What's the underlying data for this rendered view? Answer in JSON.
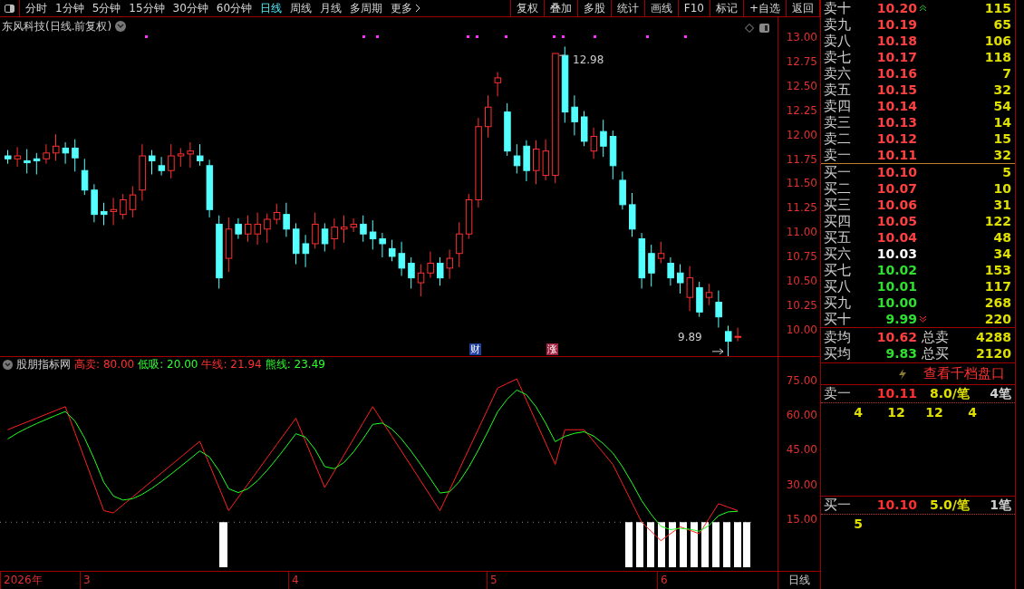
{
  "toolbar": {
    "periods": [
      {
        "label": "分时",
        "selected": false
      },
      {
        "label": "1分钟",
        "selected": false
      },
      {
        "label": "5分钟",
        "selected": false
      },
      {
        "label": "15分钟",
        "selected": false
      },
      {
        "label": "30分钟",
        "selected": false
      },
      {
        "label": "60分钟",
        "selected": false
      },
      {
        "label": "日线",
        "selected": true
      },
      {
        "label": "周线",
        "selected": false
      },
      {
        "label": "月线",
        "selected": false
      },
      {
        "label": "多周期",
        "selected": false
      },
      {
        "label": "更多",
        "selected": false
      }
    ],
    "buttons": [
      "复权",
      "叠加",
      "多股",
      "统计",
      "画线",
      "F10",
      "标记",
      "+自选",
      "返回"
    ]
  },
  "price_chart": {
    "title": "东风科技(日线.前复权)",
    "y_labels": [
      "13.00",
      "12.75",
      "12.50",
      "12.25",
      "12.00",
      "11.75",
      "11.50",
      "11.25",
      "11.00",
      "10.75",
      "10.50",
      "10.25",
      "10.00"
    ],
    "high_label": "12.98",
    "low_label": "9.89",
    "event_markers": [
      "财",
      "涨"
    ]
  },
  "indicator": {
    "name": "股朋指标网",
    "values": [
      {
        "label": "高卖:",
        "value": "80.00",
        "color": "#ff3030"
      },
      {
        "label": "低吸:",
        "value": "20.00",
        "color": "#30ff30"
      },
      {
        "label": "牛线:",
        "value": "21.94",
        "color": "#ff3030"
      },
      {
        "label": "熊线:",
        "value": "23.49",
        "color": "#30ff30"
      }
    ],
    "y_labels": [
      "75.00",
      "60.00",
      "45.00",
      "30.00",
      "15.00"
    ]
  },
  "x_axis": {
    "labels": [
      "2026年",
      "3",
      "4",
      "5",
      "6"
    ],
    "period": "日线"
  },
  "order_book": {
    "asks": [
      {
        "label": "卖十",
        "price": "10.20",
        "qty": "115",
        "color": "#ff4040",
        "limit_up": true
      },
      {
        "label": "卖九",
        "price": "10.19",
        "qty": "65",
        "color": "#ff4040"
      },
      {
        "label": "卖八",
        "price": "10.18",
        "qty": "106",
        "color": "#ff4040"
      },
      {
        "label": "卖七",
        "price": "10.17",
        "qty": "118",
        "color": "#ff4040"
      },
      {
        "label": "卖六",
        "price": "10.16",
        "qty": "7",
        "color": "#ff4040"
      },
      {
        "label": "卖五",
        "price": "10.15",
        "qty": "32",
        "color": "#ff4040"
      },
      {
        "label": "卖四",
        "price": "10.14",
        "qty": "54",
        "color": "#ff4040"
      },
      {
        "label": "卖三",
        "price": "10.13",
        "qty": "14",
        "color": "#ff4040"
      },
      {
        "label": "卖二",
        "price": "10.12",
        "qty": "15",
        "color": "#ff4040"
      },
      {
        "label": "卖一",
        "price": "10.11",
        "qty": "32",
        "color": "#ff4040"
      }
    ],
    "bids": [
      {
        "label": "买一",
        "price": "10.10",
        "qty": "5",
        "color": "#ff4040"
      },
      {
        "label": "买二",
        "price": "10.07",
        "qty": "10",
        "color": "#ff4040"
      },
      {
        "label": "买三",
        "price": "10.06",
        "qty": "31",
        "color": "#ff4040"
      },
      {
        "label": "买四",
        "price": "10.05",
        "qty": "122",
        "color": "#ff4040"
      },
      {
        "label": "买五",
        "price": "10.04",
        "qty": "48",
        "color": "#ff4040"
      },
      {
        "label": "买六",
        "price": "10.03",
        "qty": "34",
        "color": "#ffffff"
      },
      {
        "label": "买七",
        "price": "10.02",
        "qty": "153",
        "color": "#30e030"
      },
      {
        "label": "买八",
        "price": "10.01",
        "qty": "117",
        "color": "#30e030"
      },
      {
        "label": "买九",
        "price": "10.00",
        "qty": "268",
        "color": "#30e030"
      },
      {
        "label": "买十",
        "price": "9.99",
        "qty": "220",
        "color": "#30e030",
        "limit_down": true
      }
    ],
    "summary": [
      {
        "label": "卖均",
        "price": "10.62",
        "color": "#ff4040",
        "total_label": "总卖",
        "total": "4288"
      },
      {
        "label": "买均",
        "price": "9.83",
        "color": "#30e030",
        "total_label": "总买",
        "total": "2120"
      }
    ],
    "depth_link": "查看千档盘口",
    "queues": [
      {
        "label": "卖一",
        "price": "10.11",
        "average": "8.0/笔",
        "count": "4笔",
        "orders": [
          "4",
          "12",
          "12",
          "4"
        ]
      },
      {
        "label": "买一",
        "price": "10.10",
        "average": "5.0/笔",
        "count": "1笔",
        "orders": [
          "5"
        ]
      }
    ]
  }
}
